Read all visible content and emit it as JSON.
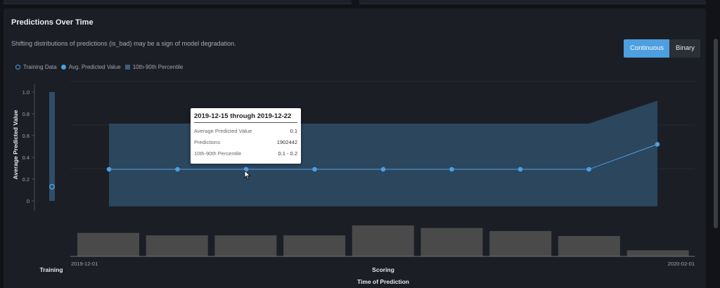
{
  "panel": {
    "title": "Predictions Over Time",
    "subtitle": "Shifting distributions of predictions (is_bad) may be a sign of model degradation."
  },
  "toggle": {
    "continuous_label": "Continuous",
    "binary_label": "Binary",
    "selected": "Continuous"
  },
  "legend": {
    "training": "Training Data",
    "avg": "Avg. Predicted Value",
    "percentile": "10th-90th Percentile"
  },
  "colors": {
    "accent": "#4d9fe0",
    "band": "#2f4d68",
    "bars": "#4a4a4a",
    "panel": "#1b1e25"
  },
  "chart_data": {
    "type": "line",
    "ylabel": "Average Predicted Value",
    "xlabel": "Time of Prediction",
    "ylim": [
      0,
      1
    ],
    "yticks": [
      "1.0",
      "0.8",
      "0.6",
      "0.4",
      "0.2",
      "0"
    ],
    "training": {
      "label": "Training",
      "avg": 0.13,
      "range": [
        0,
        1.0
      ]
    },
    "scoring": {
      "label": "Scoring",
      "x_start": "2019-12-01",
      "x_end": "2020-02-01",
      "avg": [
        0.29,
        0.29,
        0.29,
        0.29,
        0.29,
        0.29,
        0.29,
        0.29,
        0.52
      ],
      "p10": [
        -0.05,
        -0.05,
        -0.05,
        -0.05,
        -0.05,
        -0.05,
        -0.05,
        -0.05,
        -0.05
      ],
      "p90": [
        0.71,
        0.71,
        0.71,
        0.71,
        0.71,
        0.71,
        0.71,
        0.71,
        0.92
      ],
      "volume": [
        0.76,
        0.68,
        0.68,
        0.68,
        1.0,
        0.92,
        0.82,
        0.66,
        0.2
      ]
    }
  },
  "tooltip": {
    "title": "2019-12-15 through 2019-12-22",
    "rows": [
      {
        "label": "Average Predicted Value",
        "value": "0.1"
      },
      {
        "label": "Predictions",
        "value": "1902442"
      },
      {
        "label": "10th-90th Percentile",
        "value": "0.1 - 0.2"
      }
    ]
  }
}
